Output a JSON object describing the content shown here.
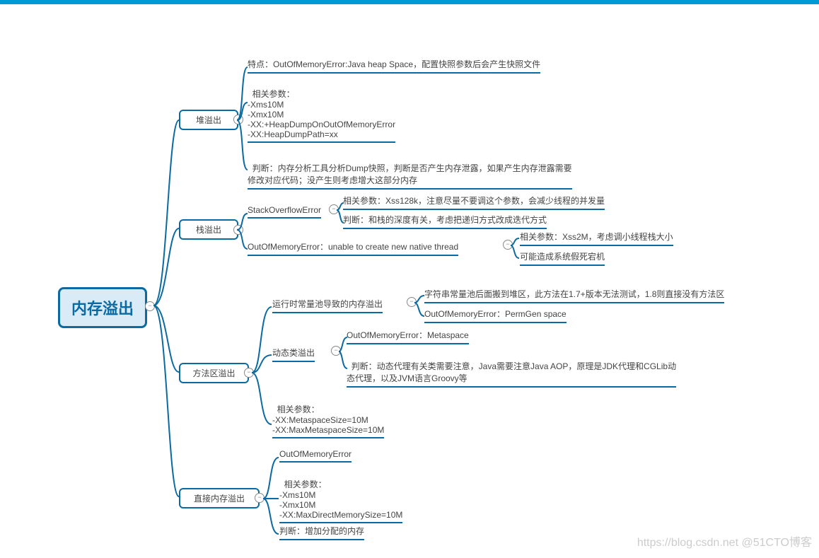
{
  "root": "内存溢出",
  "branches": {
    "heap": {
      "title": "堆溢出",
      "items": {
        "feature": "特点：OutOfMemoryError:Java heap Space，配置快照参数后会产生快照文件",
        "params": "相关参数：\n-Xms10M\n-Xmx10M\n-XX:+HeapDumpOnOutOfMemoryError\n-XX:HeapDumpPath=xx",
        "judge": "判断：内存分析工具分析Dump快照，判断是否产生内存泄露，如果产生内存泄露需要\n修改对应代码；没产生则考虑增大这部分内存"
      }
    },
    "stack": {
      "title": "栈溢出",
      "items": {
        "sof": "StackOverflowError",
        "sof_params": "相关参数：Xss128k，注意尽量不要调这个参数，会减少线程的并发量",
        "sof_judge": "判断：和栈的深度有关，考虑把递归方式改成迭代方式",
        "oom": "OutOfMemoryError：unable to create new native thread",
        "oom_params": "相关参数：Xss2M，考虑调小线程栈大小",
        "oom_effect": "可能造成系统假死宕机"
      }
    },
    "method": {
      "title": "方法区溢出",
      "items": {
        "constpool": "运行时常量池导致的内存溢出",
        "constpool_note": "字符串常量池后面搬到堆区，此方法在1.7+版本无法测试，1.8则直接没有方法区",
        "constpool_err": "OutOfMemoryError：PermGen space",
        "dynclass": "动态类溢出",
        "dynclass_err": "OutOfMemoryError：Metaspace",
        "dynclass_judge": "判断：动态代理有关类需要注意，Java需要注意Java AOP，原理是JDK代理和CGLib动\n态代理，以及JVM语言Groovy等",
        "params": "相关参数：\n-XX:MetaspaceSize=10M\n-XX:MaxMetaspaceSize=10M"
      }
    },
    "direct": {
      "title": "直接内存溢出",
      "items": {
        "err": "OutOfMemoryError",
        "params": "相关参数：\n-Xms10M\n-Xmx10M\n-XX:MaxDirectMemorySize=10M",
        "judge": "判断：增加分配的内存"
      }
    }
  },
  "watermark": "https://blog.csdn.net    @51CTO博客"
}
